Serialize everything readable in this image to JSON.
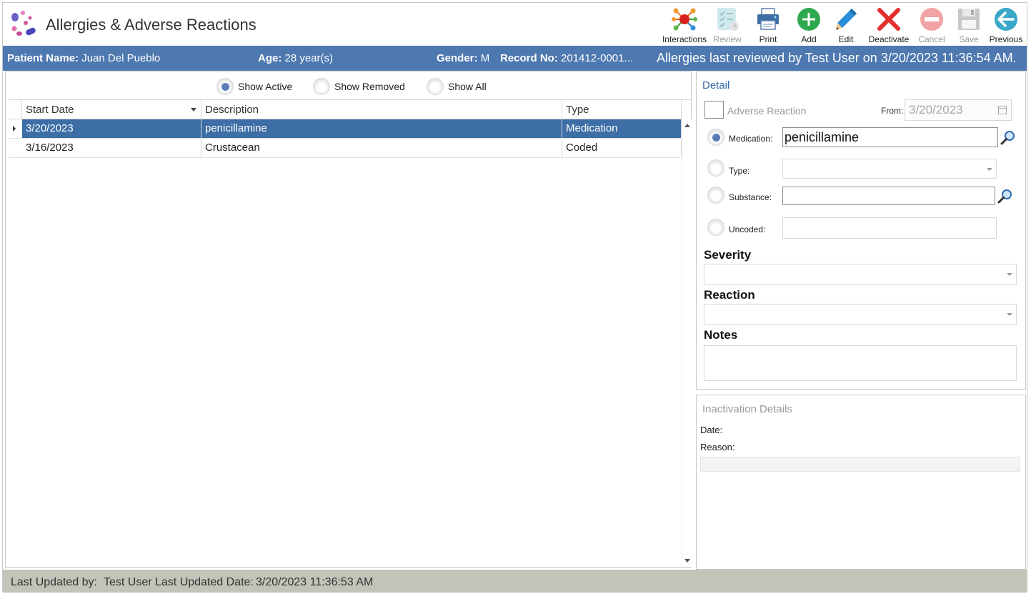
{
  "app": {
    "title": "Allergies & Adverse Reactions"
  },
  "toolbar": {
    "interactions": "Interactions",
    "review": "Review",
    "print": "Print",
    "add": "Add",
    "edit": "Edit",
    "deactivate": "Deactivate",
    "cancel": "Cancel",
    "save": "Save",
    "previous": "Previous"
  },
  "patient": {
    "name_label": "Patient Name:",
    "name": "Juan Del Pueblo",
    "age_label": "Age:",
    "age": "28 year(s)",
    "gender_label": "Gender:",
    "gender": "M",
    "record_label": "Record No:",
    "record": "201412-0001...",
    "review_text": "Allergies last reviewed by Test User on 3/20/2023 11:36:54 AM."
  },
  "filters": {
    "show_active": "Show Active",
    "show_removed": "Show Removed",
    "show_all": "Show All",
    "selected": "show_active"
  },
  "grid": {
    "columns": [
      "Start Date",
      "Description",
      "Type"
    ],
    "rows": [
      {
        "start_date": "3/20/2023",
        "description": "penicillamine",
        "type": "Medication",
        "selected": true
      },
      {
        "start_date": "3/16/2023",
        "description": "Crustacean",
        "type": "Coded",
        "selected": false
      }
    ]
  },
  "detail": {
    "title": "Detail",
    "adverse_reaction_label": "Adverse Reaction",
    "from_label": "From:",
    "from_value": "3/20/2023",
    "medication_label": "Medication:",
    "medication_value": "penicillamine",
    "type_label": "Type:",
    "type_value": "",
    "substance_label": "Substance:",
    "substance_value": "",
    "uncoded_label": "Uncoded:",
    "uncoded_value": "",
    "severity_label": "Severity",
    "reaction_label": "Reaction",
    "notes_label": "Notes"
  },
  "inactivation": {
    "title": "Inactivation Details",
    "date_label": "Date:",
    "reason_label": "Reason:"
  },
  "footer": {
    "updated_by_label": "Last Updated by:",
    "updated_by": "Test User",
    "updated_date_label": "Last Updated Date:",
    "updated_date": "3/20/2023 11:36:53 AM"
  },
  "colors": {
    "patient_bar": "#4d78b0",
    "selected_row": "#3d6ea5",
    "accent_text": "#3469a8",
    "footer": "#c4c3b9"
  }
}
